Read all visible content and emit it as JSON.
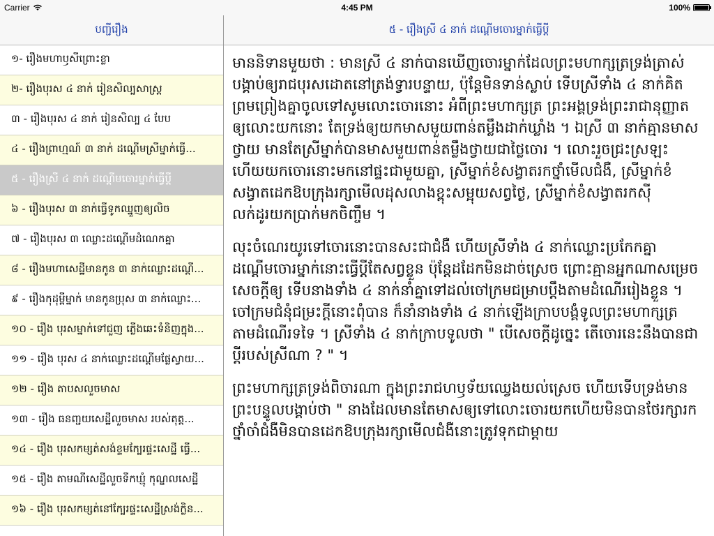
{
  "status": {
    "carrier": "Carrier",
    "time": "4:45 PM",
    "battery": "100%",
    "battery_level": 1.0
  },
  "master": {
    "title": "បញ្ជីរឿង",
    "items": [
      {
        "label": "១- រឿងមហាឫសីព្រោះខ្លា"
      },
      {
        "label": "២- រឿងបុរស ៤ នាក់ រៀនសិល្បសាស្ត្រ"
      },
      {
        "label": "៣ - រឿងបុរស ៤ នាក់ រៀនសិល្ប ៤ បែប"
      },
      {
        "label": "៤ - រឿងព្រាហ្មណ៍ ៣ នាក់ ដណ្ដើមស្រីម្នាក់ធ្វើ..."
      },
      {
        "label": "៥ - រឿងស្រី ៤ នាក់ ដណ្តើមចោរម្នាក់ធ្វើប្ដី"
      },
      {
        "label": "៦ - រឿងបុរស ៣ នាក់ធ្វើទូកឈ្នួញឲ្យលិច"
      },
      {
        "label": "៧ - រឿងបុរស ៣ ឈ្លោះដណ្ដើមដំណេកគ្នា"
      },
      {
        "label": "៨ - រឿងមហាសេដ្ឋីមានកូន ៣ នាក់ឈ្លោះដណ្ដើ..."
      },
      {
        "label": "៩ - រឿងកុដុម្ពីម្នាក់ មានកូនប្រុស ៣ នាក់ឈ្លោះ..."
      },
      {
        "label": "១០ - រឿង បុរសម្នាក់ទៅជួញ ភ្លើងឆេះទំនិញក្នុង..."
      },
      {
        "label": "១១ - រឿង បុរស ៤ នាក់ឈ្លោះដណ្ដើមផ្លែស្វាយ..."
      },
      {
        "label": "១២ - រឿង តាបសលួចមាស"
      },
      {
        "label": "១៣ - រឿង ធនញ្ជយសេដ្ឋីលួចមាស របស់តុត្ត..."
      },
      {
        "label": "១៤ - រឿង បុរសកម្សត់សង់ខ្ទមក្បែរផ្ទះសេដ្ឋី ធ្វើ..."
      },
      {
        "label": "១៥ - រឿង តាមណីសេដ្ឋីលួចទឹកឃ្មុំ កុណ្ឌលសេដ្ឋី"
      },
      {
        "label": "១៦ - រឿង បុរសកម្សត់នៅក្បែរផ្ទះសេដ្ឋីស្រង់ក្លិន..."
      }
    ],
    "selected_index": 4
  },
  "detail": {
    "title": "៥ - រឿងស្រី ៤ នាក់ ដណ្តើមចោរម្នាក់ធ្វើប្ដី",
    "paragraphs": [
      "មាននិទានមួយថា : មានស្រី ៤ នាក់បានឃើញចោរម្នាក់ដែលព្រះមហាក្សត្រទ្រង់ត្រាស់បង្គាប់ឲ្យរាជបុរសដោតនៅត្រង់ទ្វារបន្ទាយ, ប៉ុន្តែមិនទាន់ស្លាប់ ទើបស្រីទាំង ៤ នាក់គិតព្រមព្រៀងគ្នាចូលទៅសូមលោះចោរនោះ អំពីព្រះមហាក្សត្រ ព្រះអង្គទ្រង់ព្រះរាជានុញ្ញាតឲ្យលោះយកនោះ តែទ្រង់ឲ្យយកមាសមួយពាន់តម្លឹងដាក់ឃ្លាំង ។ ឯស្រី ៣ នាក់គ្មានមាសថ្វាយ មានតែស្រីម្នាក់បានមាសមួយពាន់តម្លឹងថ្វាយជាថ្លៃចោរ ។ លោះរួចជ្រះស្រឡះហើយយកចោរនោះមកនៅផ្ទះជាមួយគ្នា, ស្រីម្នាក់ខំសង្វាតរកថ្នាំមើលជំងឺ, ស្រីម្នាក់ខំសង្វាតដេកឱបក្រុងរក្សាមើលដុសលាងខ្ពុះសម្អុយសព្វថ្ងៃ, ស្រីម្នាក់ខំសង្វាតរកស៊ីលក់ដូរយកប្រាក់មកចិញ្ចឹម ។",
      "លុះចំណេរយូរទៅចោរនោះបានសះជាជំងឺ ហើយស្រីទាំង ៤ នាក់ឈ្លោះប្រកែកគ្នាដណ្ដើមចោរម្នាក់នោះធ្វើប្ដីតែសព្វខ្លួន ប៉ុន្តែដដែកមិនដាច់ស្រេច ព្រោះគ្មានអ្នកណាសម្រេចសេចក្ដីឲ្យ ទើបនាងទាំង ៤ នាក់នាំគ្នាទៅដល់ចៅក្រមជម្រាបប្ដឹងតាមដំណើររៀងខ្លួន ។ ចៅក្រមជំនុំជម្រះក្ដីនោះពុំបាន ក៏នាំនាងទាំង ៤ នាក់ឡើងក្រាបបង្គំទូលព្រះមហាក្សត្រតាមដំណើរទទៃ ។ ស្រីទាំង ៤ នាក់ក្រាបទូលថា \" បើសេចក្ដីដូច្នេះ តើចោរនេះនឹងបានជាប្ដីរបស់ស្រីណា ? \" ។",
      "ព្រះមហាក្សត្រទ្រង់ពិចារណា ក្នុងព្រះរាជហឫទ័យឈ្វេងយល់ស្រេច ហើយទើបទ្រង់មានព្រះបន្ទូលបង្គាប់ថា \" នាងដែលមានតែមាសឲ្យទៅលោះចោរយកហើយមិនបានថែរក្សារកថ្នាំចាំជំងឺមិនបានដេកឱបក្រុងរក្សាមើលជំងឺនោះត្រូវទុកជាម្ដាយ"
    ]
  }
}
